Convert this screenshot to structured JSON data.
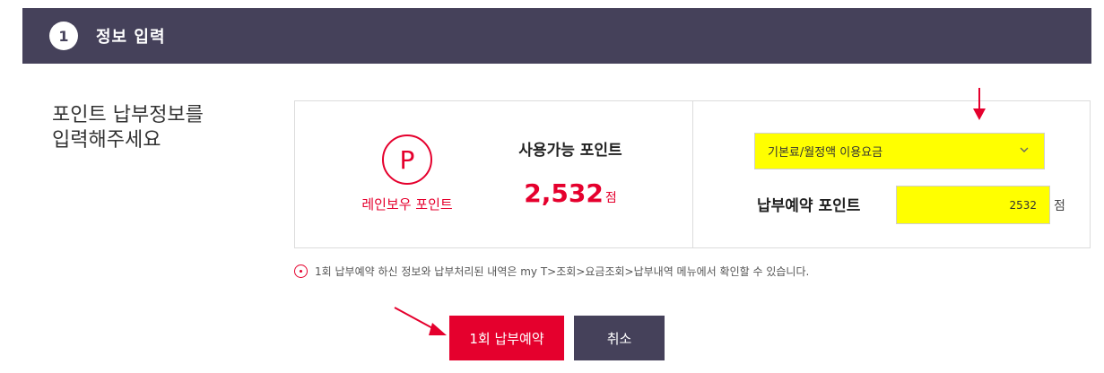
{
  "header": {
    "step": "1",
    "title": "정보 입력"
  },
  "intro": {
    "line1": "포인트 납부정보를",
    "line2": "입력해주세요"
  },
  "points": {
    "logo_letter": "P",
    "brand_name": "레인보우 포인트",
    "available_label": "사용가능 포인트",
    "available_value": "2,532",
    "unit": "점"
  },
  "payment": {
    "target_select": "기본료/월정액 이용요금",
    "reserve_label": "납부예약 포인트",
    "reserve_value": "2532",
    "unit": "점"
  },
  "notice": "1회 납부예약 하신 정보와 납부처리된 내역은 my T>조회>요금조회>납부내역 메뉴에서 확인할 수 있습니다.",
  "buttons": {
    "reserve": "1회 납부예약",
    "cancel": "취소"
  },
  "colors": {
    "accent": "#e5002d",
    "dark": "#45415a",
    "highlight": "#ffff00"
  },
  "icons": [
    "chevron-down-icon",
    "info-icon",
    "arrow-annotation-icon"
  ]
}
